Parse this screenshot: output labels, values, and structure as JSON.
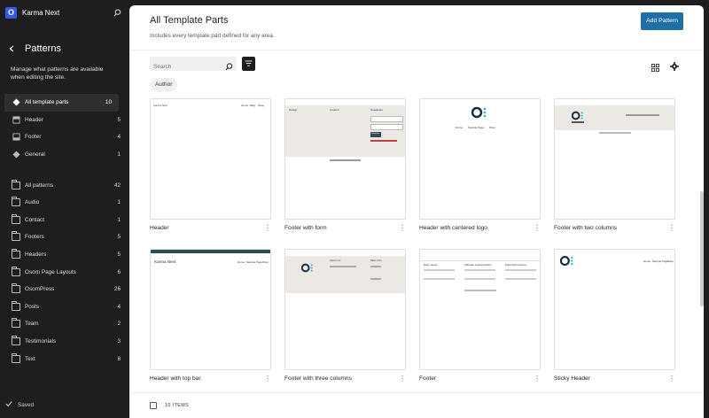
{
  "site": {
    "name": "Karma Next",
    "logo_letter": "O"
  },
  "sidebar": {
    "title": "Patterns",
    "description": "Manage what patterns are available when editing the site.",
    "template_items": [
      {
        "label": "All template parts",
        "count": "10",
        "icon": "diamond-icon"
      },
      {
        "label": "Header",
        "count": "5",
        "icon": "header-icon"
      },
      {
        "label": "Footer",
        "count": "4",
        "icon": "footer-icon"
      },
      {
        "label": "General",
        "count": "1",
        "icon": "diamond-icon"
      }
    ],
    "pattern_items": [
      {
        "label": "All patterns",
        "count": "42"
      },
      {
        "label": "Audio",
        "count": "1"
      },
      {
        "label": "Contact",
        "count": "1"
      },
      {
        "label": "Footers",
        "count": "5"
      },
      {
        "label": "Headers",
        "count": "5"
      },
      {
        "label": "Osom Page Layouts",
        "count": "6"
      },
      {
        "label": "OsomPress",
        "count": "26"
      },
      {
        "label": "Posts",
        "count": "4"
      },
      {
        "label": "Team",
        "count": "2"
      },
      {
        "label": "Testimonials",
        "count": "3"
      },
      {
        "label": "Text",
        "count": "8"
      }
    ],
    "saved_label": "Saved"
  },
  "main": {
    "title": "All Template Parts",
    "description": "Includes every template part defined for any area.",
    "add_button": "Add Pattern",
    "search_placeholder": "Search",
    "author_chip": "Author",
    "items_count": "10 ITEMS",
    "cards": [
      {
        "label": "Header"
      },
      {
        "label": "Footer with form"
      },
      {
        "label": "Header with centered logo"
      },
      {
        "label": "Footer with two columns"
      },
      {
        "label": "Header with top bar"
      },
      {
        "label": "Footer with three columns"
      },
      {
        "label": "Footer"
      },
      {
        "label": "Sticky Header"
      }
    ],
    "previews": {
      "header_site": "Karma Next",
      "nav": [
        "Home",
        "Blog",
        "Shop"
      ],
      "form_cols": [
        "Design",
        "Content",
        "Newsletter"
      ],
      "form_btn": "Subscribe",
      "centered_nav": [
        "Home",
        "Sample Page",
        "Shop"
      ],
      "three_cols": [
        "About Us",
        "More Info"
      ],
      "footer_cols": [
        "Easy Setup",
        "Ultimate Customization",
        "Fast Performance"
      ],
      "sticky_nav": [
        "Home",
        "Sample Page",
        "Shop"
      ]
    }
  },
  "colors": {
    "accent": "#1e6fa8",
    "sidebar": "#1e1e1e",
    "preview_bg": "#ece8e4",
    "logo": "#1a2a40",
    "logo_dot": "#2ab7c9"
  }
}
